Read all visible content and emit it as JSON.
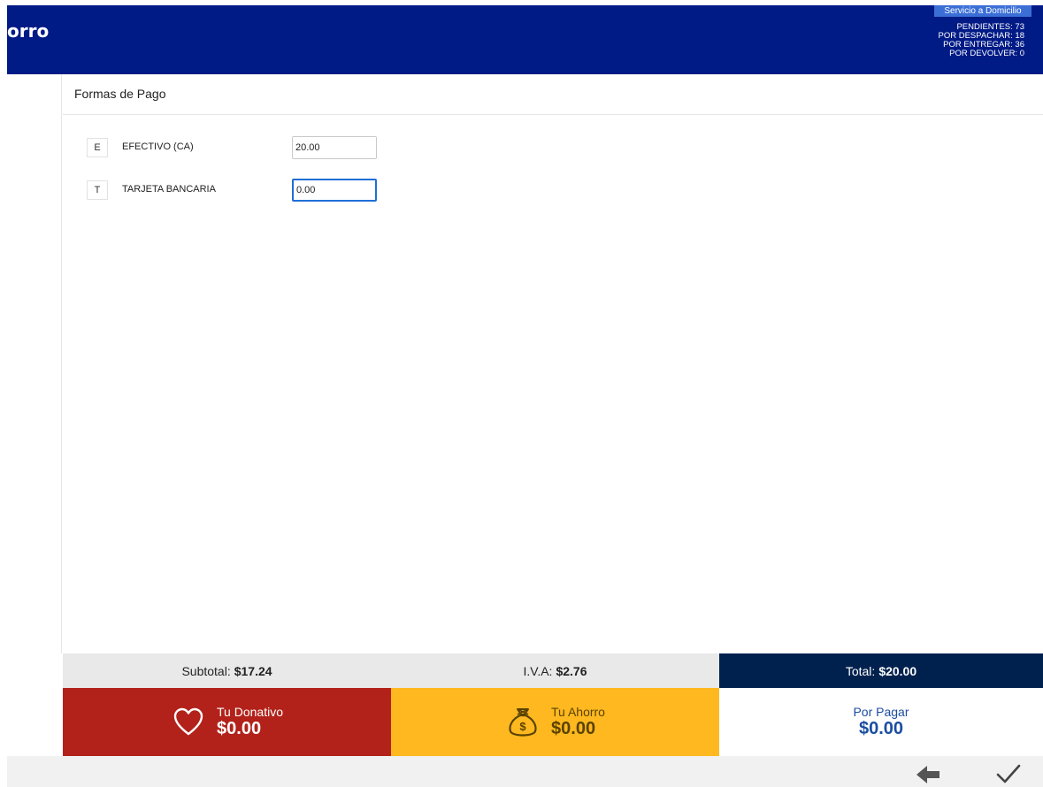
{
  "header": {
    "brand": "orro",
    "service_badge": "Servicio a Domicilio",
    "stats": [
      "PENDIENTES: 73",
      "POR DESPACHAR: 18",
      "POR ENTREGAR: 36",
      "POR DEVOLVER: 0"
    ],
    "bg_color": "#001a86"
  },
  "section": {
    "title": "Formas de Pago"
  },
  "payments": [
    {
      "key": "E",
      "label": "EFECTIVO (CA)",
      "value": "20.00"
    },
    {
      "key": "T",
      "label": "TARJETA BANCARIA",
      "value": "0.00"
    }
  ],
  "totals": {
    "subtotal_label": "Subtotal:",
    "subtotal_value": "$17.24",
    "iva_label": "I.V.A:",
    "iva_value": "$2.76",
    "total_label": "Total:",
    "total_value": "$20.00"
  },
  "summary": {
    "donativo_label": "Tu Donativo",
    "donativo_value": "$0.00",
    "ahorro_label": "Tu Ahorro",
    "ahorro_value": "$0.00",
    "pagar_label": "Por Pagar",
    "pagar_value": "$0.00"
  },
  "footer": {
    "back_icon": "arrow-left-icon",
    "confirm_icon": "checkmark-icon"
  },
  "colors": {
    "donativo": "#b2221a",
    "ahorro": "#ffb81f",
    "total": "#00214e",
    "pagar_text": "#1b4da3"
  }
}
